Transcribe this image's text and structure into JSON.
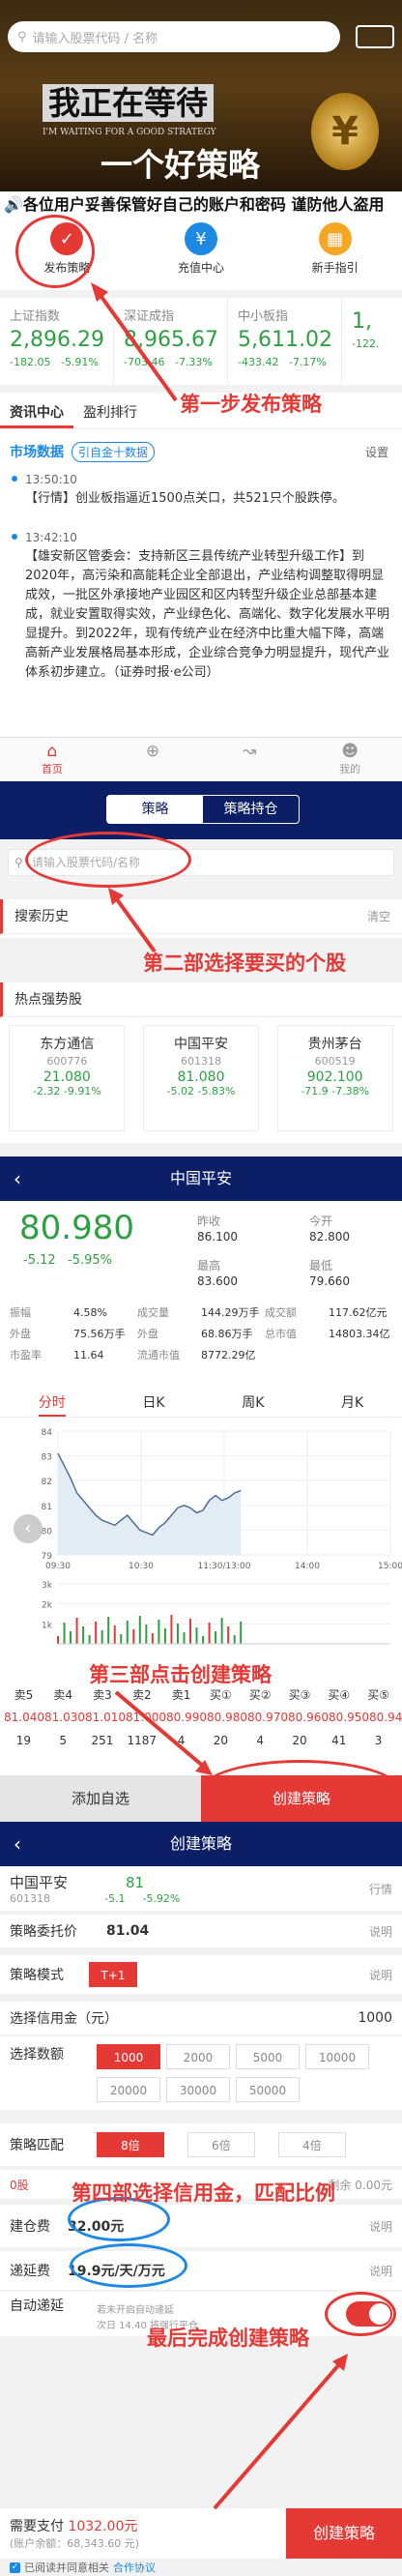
{
  "p1": {
    "search_placeholder": "请输入股票代码 / 名称",
    "slogan_line1": "我正在等待",
    "slogan_sub": "I'M WAITING FOR A GOOD STRATEGY",
    "slogan_line2": "一个好策略",
    "banner_coin": "¥",
    "marquee": "各位用户妥善保管好自己的账户和密码 谨防他人盗用",
    "quick": [
      {
        "label": "发布策略",
        "icon": "publish-strategy-icon",
        "color": "#e53935"
      },
      {
        "label": "充值中心",
        "icon": "recharge-icon",
        "color": "#1e88e5"
      },
      {
        "label": "新手指引",
        "icon": "guide-icon",
        "color": "#f5a623"
      }
    ],
    "indices": [
      {
        "name": "上证指数",
        "value": "2,896.29",
        "chg": "-182.05",
        "pct": "-5.91%"
      },
      {
        "name": "深证成指",
        "value": "8,965.67",
        "chg": "-703.46",
        "pct": "-7.33%"
      },
      {
        "name": "中小板指",
        "value": "5,611.02",
        "chg": "-433.42",
        "pct": "-7.17%"
      },
      {
        "name": "",
        "value": "1,",
        "chg": "-122.",
        "pct": ""
      }
    ],
    "tabs": [
      "资讯中心",
      "盈利排行"
    ],
    "market_label": "市场数据",
    "market_pill": "引自金十数据",
    "settings": "设置",
    "news": [
      {
        "time": "13:50:10",
        "text": "【行情】创业板指逼近1500点关口，共521只个股跌停。"
      },
      {
        "time": "13:42:10",
        "text": "【雄安新区管委会：支持新区三县传统产业转型升级工作】到2020年，高污染和高能耗企业全部退出，产业结构调整取得明显成效，一批区外承接地产业园区和区内转型升级企业总部基本建成，就业安置取得实效，产业绿色化、高端化、数字化发展水平明显提升。到2022年，现有传统产业在经济中比重大幅下降，高端高新产业发展格局基本形成，企业综合竞争力明显提升，现代产业体系初步建立。（证券时报·e公司）"
      }
    ],
    "nav": [
      "首页",
      "",
      "",
      "我的"
    ],
    "annotation": "第一步发布策略"
  },
  "p2": {
    "seg": [
      "策略",
      "策略持仓"
    ],
    "search_placeholder": "请输入股票代码/名称",
    "history": "搜索历史",
    "clear": "清空",
    "hot_title": "热点强势股",
    "hot": [
      {
        "name": "东方通信",
        "code": "600776",
        "price": "21.080",
        "chg": "-2.32 -9.91%"
      },
      {
        "name": "中国平安",
        "code": "601318",
        "price": "81.080",
        "chg": "-5.02 -5.83%"
      },
      {
        "name": "贵州茅台",
        "code": "600519",
        "price": "902.100",
        "chg": "-71.9 -7.38%"
      }
    ],
    "annotation": "第二部选择要买的个股"
  },
  "p3": {
    "title": "中国平安",
    "price": "80.980",
    "chg": "-5.12",
    "pct": "-5.95%",
    "kv": [
      [
        "昨收",
        "86.100"
      ],
      [
        "今开",
        "82.800"
      ],
      [
        "最高",
        "83.600"
      ],
      [
        "最低",
        "79.660"
      ]
    ],
    "stats": [
      [
        "振幅",
        "4.58%",
        "成交量",
        "144.29万手",
        "成交额",
        "117.62亿元"
      ],
      [
        "外盘",
        "75.56万手",
        "外盘",
        "68.86万手",
        "总市值",
        "14803.34亿"
      ],
      [
        "市盈率",
        "11.64",
        "流通市值",
        "8772.29亿",
        "",
        ""
      ]
    ],
    "period_tabs": [
      "分时",
      "日K",
      "周K",
      "月K"
    ],
    "chart_data": {
      "type": "line",
      "x": [
        "09:30",
        "10:30",
        "11:30/13:00",
        "14:00",
        "15:00"
      ],
      "ylim": [
        79,
        84
      ],
      "yticks": [
        "84",
        "83",
        "82",
        "81",
        "80",
        "79"
      ],
      "values": [
        83.1,
        82.6,
        82.1,
        81.5,
        81.2,
        80.9,
        80.6,
        80.4,
        80.3,
        80.2,
        80.4,
        80.6,
        80.3,
        80.0,
        79.9,
        79.8,
        80.1,
        80.3,
        80.6,
        80.9,
        81.0,
        80.9,
        80.7,
        80.8,
        81.2,
        81.4,
        81.2,
        81.3,
        81.5,
        81.6
      ],
      "vol_yticks": [
        "3k",
        "2k",
        "1k"
      ]
    },
    "order_heads": [
      "卖5",
      "卖4",
      "卖3",
      "卖2",
      "卖1",
      "买①",
      "买②",
      "买③",
      "买④",
      "买⑤"
    ],
    "order_prices": [
      "81.040",
      "81.030",
      "81.010",
      "81.000",
      "80.990",
      "80.980",
      "80.970",
      "80.960",
      "80.950",
      "80.940"
    ],
    "order_vols": [
      "19",
      "5",
      "251",
      "1187",
      "4",
      "20",
      "4",
      "20",
      "41",
      "3"
    ],
    "add_watch": "添加自选",
    "create": "创建策略",
    "annotation": "第三部点击创建策略"
  },
  "p4": {
    "title": "创建策略",
    "stock": "中国平安",
    "stock_price": "81",
    "code": "601318",
    "chg": "-5.1",
    "pct": "-5.92%",
    "quote": "行情",
    "entrust_label": "策略委托价",
    "entrust": "81.04",
    "explain": "说明",
    "mode_label": "策略模式",
    "mode": "T+1",
    "credit_label": "选择信用金（元）",
    "credit": "1000",
    "amount_label": "选择数额",
    "amounts": [
      "1000",
      "2000",
      "5000",
      "10000",
      "20000",
      "30000",
      "50000"
    ],
    "match_label": "策略匹配",
    "multiples": [
      "8倍",
      "6倍",
      "4倍"
    ],
    "zero": "0股",
    "rest": "0.00元",
    "rest_label": "剩余",
    "fee_label": "建仓费",
    "fee": "32.00元",
    "defer_label": "递延费",
    "defer": "19.9元/天/万元",
    "auto_label": "自动递延",
    "auto_note1": "若未开启自动递延",
    "auto_note2": "次日 14.40 将强行平仓",
    "pay_label": "需要支付",
    "pay": "1032.00元",
    "balance_label": "(账户余额：",
    "balance": "68,343.60 元)",
    "agree": "已阅读并同意相关",
    "agree_link": "合作协议",
    "create": "创建策略",
    "annotation1": "第四部选择信用金，匹配比例",
    "annotation2": "最后完成创建策略"
  }
}
